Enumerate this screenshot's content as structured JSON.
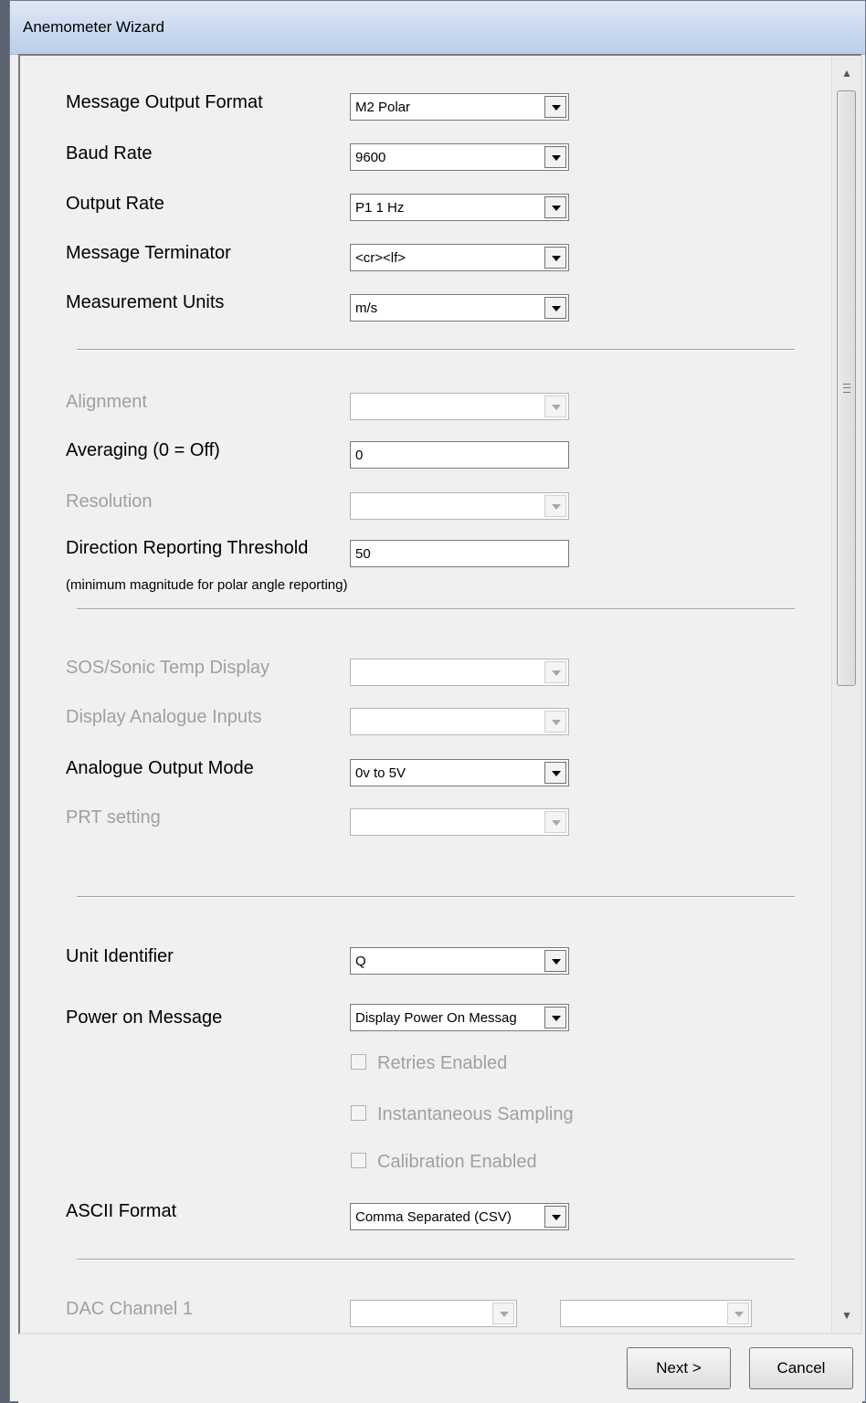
{
  "window": {
    "title": "Anemometer Wizard"
  },
  "form": {
    "message_output_format": {
      "label": "Message Output Format",
      "value": "M2 Polar"
    },
    "baud_rate": {
      "label": "Baud Rate",
      "value": "9600"
    },
    "output_rate": {
      "label": "Output Rate",
      "value": "P1 1 Hz"
    },
    "message_terminator": {
      "label": "Message Terminator",
      "value": "<cr><lf>"
    },
    "measurement_units": {
      "label": "Measurement Units",
      "value": "m/s"
    },
    "alignment": {
      "label": "Alignment",
      "value": ""
    },
    "averaging": {
      "label": "Averaging (0 = Off)",
      "value": "0"
    },
    "resolution": {
      "label": "Resolution",
      "value": ""
    },
    "direction_threshold": {
      "label": "Direction Reporting Threshold",
      "value": "50",
      "note": "(minimum magnitude for polar angle reporting)"
    },
    "sos_display": {
      "label": "SOS/Sonic Temp Display",
      "value": ""
    },
    "analogue_inputs": {
      "label": "Display Analogue Inputs",
      "value": ""
    },
    "analogue_output_mode": {
      "label": "Analogue Output  Mode",
      "value": "0v to 5V"
    },
    "prt_setting": {
      "label": "PRT setting",
      "value": ""
    },
    "unit_identifier": {
      "label": "Unit Identifier",
      "value": "Q"
    },
    "power_on_message": {
      "label": "Power on Message",
      "value": "Display Power On Messag"
    },
    "checkboxes": {
      "retries": "Retries Enabled",
      "instantaneous": "Instantaneous Sampling",
      "calibration": "Calibration Enabled"
    },
    "ascii_format": {
      "label": "ASCII Format",
      "value": "Comma Separated (CSV)"
    },
    "dac_channel_1": {
      "label": "DAC Channel 1",
      "value1": "",
      "value2": ""
    }
  },
  "buttons": {
    "next": "Next >",
    "cancel": "Cancel"
  }
}
